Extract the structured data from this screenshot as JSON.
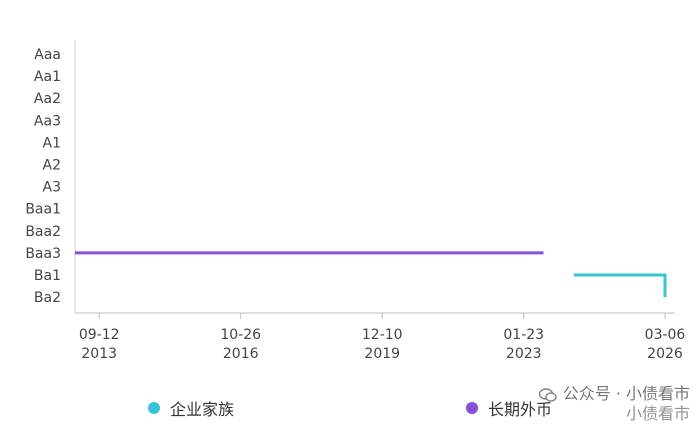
{
  "chart_data": {
    "type": "line",
    "y_categories": [
      "Aaa",
      "Aa1",
      "Aa2",
      "Aa3",
      "A1",
      "A2",
      "A3",
      "Baa1",
      "Baa2",
      "Baa3",
      "Ba1",
      "Ba2"
    ],
    "x_tick_labels": [
      {
        "date": "2013-09-12",
        "line1": "09-12",
        "line2": "2013"
      },
      {
        "date": "2016-10-26",
        "line1": "10-26",
        "line2": "2016"
      },
      {
        "date": "2019-12-10",
        "line1": "12-10",
        "line2": "2019"
      },
      {
        "date": "2023-01-23",
        "line1": "01-23",
        "line2": "2023"
      },
      {
        "date": "2026-03-06",
        "line1": "03-06",
        "line2": "2026"
      }
    ],
    "xlim": [
      "2013-03-01",
      "2026-03-06"
    ],
    "series": [
      {
        "name": "企业家族",
        "color": "#36c6d3",
        "points": [
          {
            "x": "2024-03-01",
            "y": "Ba1"
          },
          {
            "x": "2026-03-06",
            "y": "Ba1"
          },
          {
            "x": "2026-03-06",
            "y": "Ba2"
          }
        ]
      },
      {
        "name": "长期外币",
        "color": "#8a4fd8",
        "points": [
          {
            "x": "2013-03-01",
            "y": "Baa3"
          },
          {
            "x": "2023-07-01",
            "y": "Baa3"
          }
        ]
      }
    ],
    "grid": false,
    "legend_position": "bottom"
  },
  "watermark": {
    "line1": "公众号 · 小债看市",
    "line2": "小债看市"
  }
}
